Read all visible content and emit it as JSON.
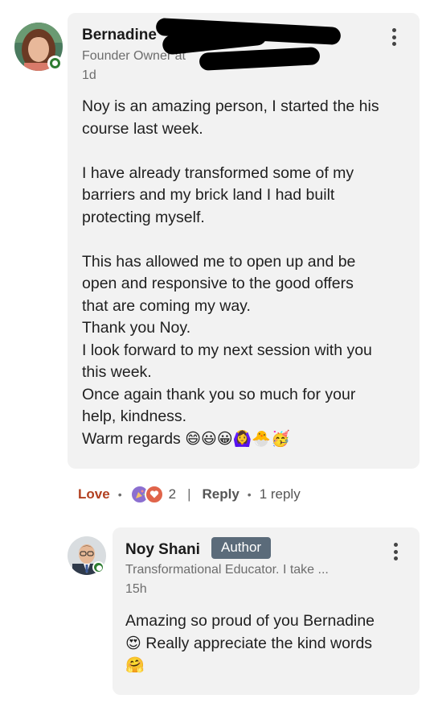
{
  "comment": {
    "author_name": "Bernadine",
    "author_headline": "Founder Owner at",
    "time": "1d",
    "paragraphs": [
      [
        "Noy is an amazing person, I started the his",
        "course last week."
      ],
      [
        "I have already transformed some of my",
        "barriers and my brick land I had built",
        "protecting myself."
      ],
      [
        "This has allowed me to open up and be",
        "open and responsive to the good offers",
        "that are coming my way.",
        "Thank you Noy.",
        "I look forward to my next session with you",
        "this week.",
        "Once again thank you so much for your",
        "help, kindness."
      ]
    ],
    "closing": "Warm regards",
    "closing_emojis": "😄😃😀🙆‍♀️🐣🥳"
  },
  "actions": {
    "love_label": "Love",
    "reaction_count": "2",
    "reply_label": "Reply",
    "reply_count": "1 reply"
  },
  "reply": {
    "author_name": "Noy Shani",
    "badge": "Author",
    "headline": "Transformational Educator. I take ...",
    "time": "15h",
    "text_line1": "Amazing so proud of you Bernadine",
    "text_line2_emoji": "😍",
    "text_line2": "Really appreciate the kind words",
    "text_line3_emoji": "🤗"
  },
  "colors": {
    "bubble": "#f2f2f2",
    "love": "#b24020",
    "badge": "#5b6b7a",
    "online": "#2e7d32"
  },
  "icons": {
    "comment_menu": "more-vertical-icon",
    "reactions": [
      "celebrate-icon",
      "love-icon"
    ]
  }
}
